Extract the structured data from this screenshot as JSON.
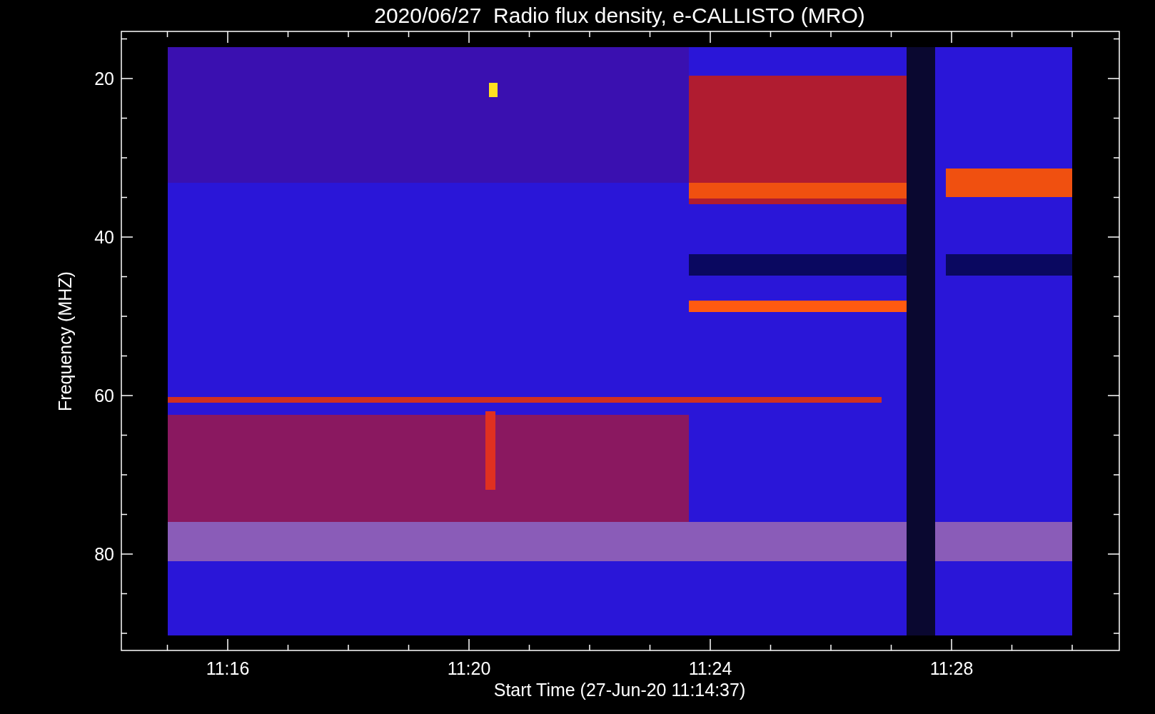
{
  "title": "2020/06/27  Radio flux density, e-CALLISTO (MRO)",
  "plot": {
    "ylabel": "Frequency (MHZ)",
    "xlabel": "Start Time (27-Jun-20 11:14:37)",
    "yticks": [
      "20",
      "40",
      "60",
      "80"
    ],
    "xticks": [
      "11:16",
      "11:20",
      "11:24",
      "11:28"
    ]
  }
}
